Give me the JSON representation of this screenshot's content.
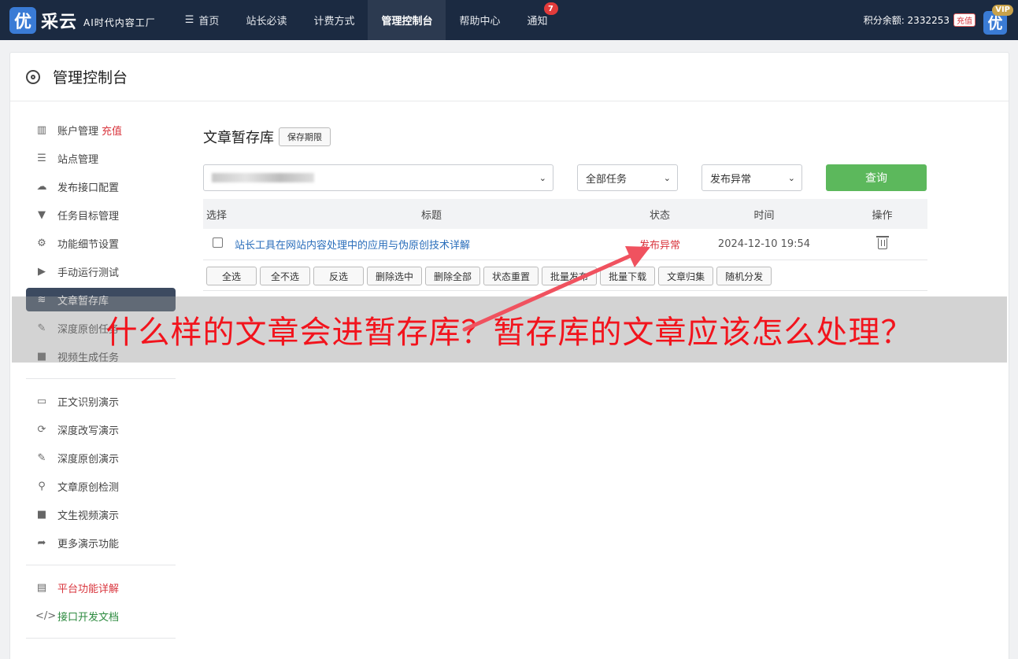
{
  "navbar": {
    "logo_mark": "优",
    "logo_text": "采云",
    "slogan": "AI时代内容工厂",
    "items": [
      {
        "label": "首页",
        "icon": "menu-icon"
      },
      {
        "label": "站长必读"
      },
      {
        "label": "计费方式"
      },
      {
        "label": "管理控制台",
        "active": true
      },
      {
        "label": "帮助中心"
      },
      {
        "label": "通知",
        "badge": "7"
      }
    ],
    "points_label": "积分余额: 2332253",
    "recharge": "充值",
    "vip_avatar": "优",
    "vip": "VIP"
  },
  "card": {
    "title": "管理控制台",
    "icon": "gear-icon"
  },
  "sidebar": {
    "items": [
      {
        "label": "账户管理",
        "extra": "充值",
        "icon": "bar-chart-icon"
      },
      {
        "label": "站点管理",
        "icon": "server-icon"
      },
      {
        "label": "发布接口配置",
        "icon": "cloud-upload-icon"
      },
      {
        "label": "任务目标管理",
        "icon": "filter-icon"
      },
      {
        "label": "功能细节设置",
        "icon": "cogs-icon"
      },
      {
        "label": "手动运行测试",
        "icon": "play-circle-icon"
      },
      {
        "label": "文章暂存库",
        "icon": "database-icon",
        "active": true
      },
      {
        "label": "深度原创任务",
        "icon": "edit-icon"
      },
      {
        "label": "视频生成任务",
        "icon": "video-icon"
      }
    ],
    "demo_items": [
      {
        "label": "正文识别演示",
        "icon": "monitor-icon"
      },
      {
        "label": "深度改写演示",
        "icon": "refresh-icon"
      },
      {
        "label": "深度原创演示",
        "icon": "edit-icon"
      },
      {
        "label": "文章原创检测",
        "icon": "search-icon"
      },
      {
        "label": "文生视频演示",
        "icon": "video-icon"
      },
      {
        "label": "更多演示功能",
        "icon": "share-icon"
      }
    ],
    "doc_items": [
      {
        "label": "平台功能详解",
        "icon": "file-icon"
      },
      {
        "label": "接口开发文档",
        "icon": "code-icon"
      }
    ]
  },
  "main": {
    "title": "文章暂存库",
    "period_button": "保存期限",
    "filters": {
      "task": "全部任务",
      "status": "发布异常",
      "query": "查询"
    },
    "table": {
      "headers": [
        "选择",
        "标题",
        "状态",
        "时间",
        "操作"
      ],
      "rows": [
        {
          "title": "站长工具在网站内容处理中的应用与伪原创技术详解",
          "status": "发布异常",
          "time": "2024-12-10 19:54"
        }
      ]
    },
    "actions": [
      "全选",
      "全不选",
      "反选",
      "删除选中",
      "删除全部",
      "状态重置",
      "批量发布",
      "批量下载",
      "文章归集",
      "随机分发"
    ]
  },
  "banner": {
    "text": "什么样的文章会进暂存库？暂存库的文章应该怎么处理？"
  },
  "colors": {
    "navbar_bg": "#1b2a41",
    "accent_green": "#5cb85c",
    "error_red": "#d9363e",
    "link_blue": "#2a6ebb",
    "arrow": "#f0525f"
  }
}
